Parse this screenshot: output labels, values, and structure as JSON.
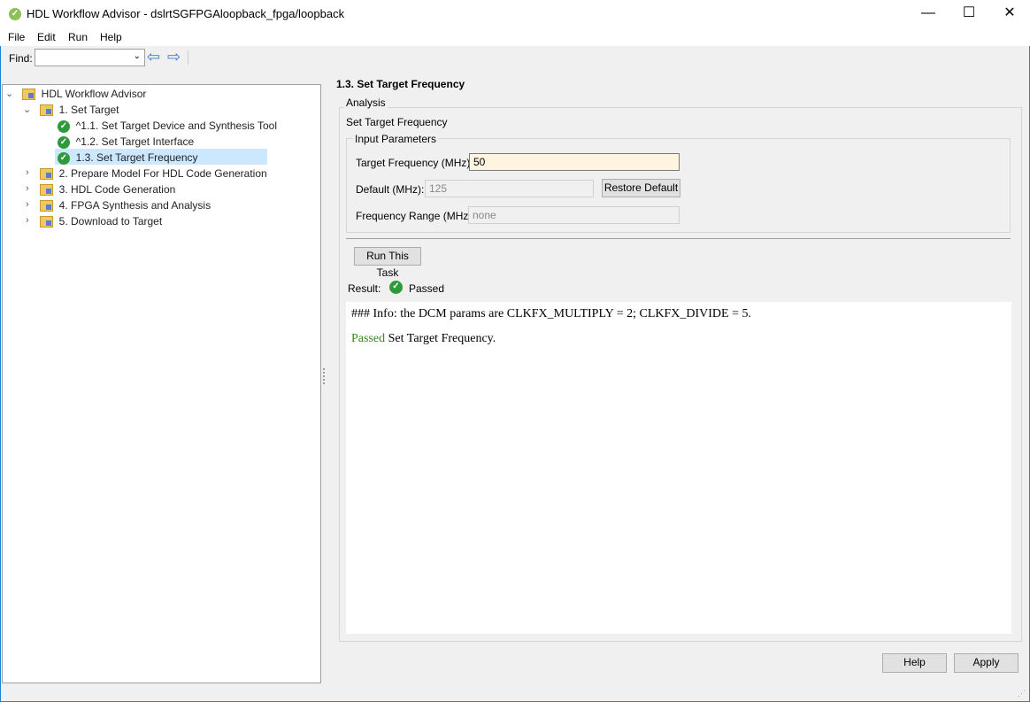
{
  "window": {
    "title": "HDL Workflow Advisor - dslrtSGFPGAloopback_fpga/loopback",
    "minimize": "—",
    "maximize": "☐",
    "close": "✕"
  },
  "menu": [
    "File",
    "Edit",
    "Run",
    "Help"
  ],
  "toolbar": {
    "find_label": "Find:",
    "find_value": "",
    "back": "⇦",
    "forward": "⇨"
  },
  "tree": {
    "root": "HDL Workflow Advisor",
    "items": [
      {
        "label": "1. Set Target"
      },
      {
        "label": "^1.1. Set Target Device and Synthesis Tool"
      },
      {
        "label": "^1.2. Set Target Interface"
      },
      {
        "label": "1.3. Set Target Frequency"
      },
      {
        "label": "2. Prepare Model For HDL Code Generation"
      },
      {
        "label": "3. HDL Code Generation"
      },
      {
        "label": "4. FPGA Synthesis and Analysis"
      },
      {
        "label": "5. Download to Target"
      }
    ]
  },
  "panel": {
    "title": "1.3. Set Target Frequency",
    "analysis_legend": "Analysis",
    "analysis_subtitle": "Set Target Frequency",
    "input_legend": "Input Parameters",
    "target_label": "Target Frequency (MHz):",
    "target_value": "50",
    "default_label": "Default (MHz):",
    "default_value": "125",
    "restore_label": "Restore Default",
    "range_label": "Frequency Range (MHz):",
    "range_value": "none",
    "run_label": "Run This Task",
    "result_label": "Result:",
    "result_value": "Passed",
    "output_line1": "### Info: the DCM params are CLKFX_MULTIPLY = 2; CLKFX_DIVIDE = 5.",
    "output_passed": "Passed",
    "output_line2": " Set Target Frequency.",
    "help_label": "Help",
    "apply_label": "Apply"
  }
}
